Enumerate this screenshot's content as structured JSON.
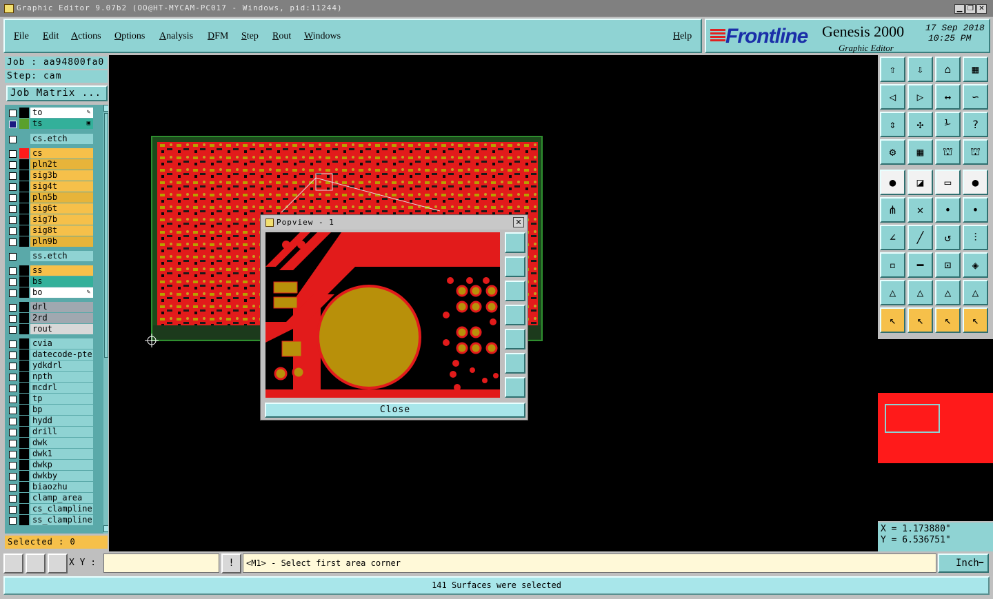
{
  "window": {
    "title": "Graphic Editor 9.07b2 (OO@HT-MYCAM-PC017 - Windows, pid:11244)",
    "btn_min": "▁",
    "btn_max": "❐",
    "btn_close": "✕"
  },
  "menu": {
    "items": [
      "File",
      "Edit",
      "Actions",
      "Options",
      "Analysis",
      "DFM",
      "Step",
      "Rout",
      "Windows"
    ],
    "help": "Help"
  },
  "brand": {
    "logo": "Frontline",
    "product": "Genesis 2000",
    "subtitle": "Graphic Editor",
    "date": "17 Sep 2018",
    "time": "10:25 PM"
  },
  "left": {
    "job": "Job : aa94800fa0",
    "step": "Step: cam",
    "job_matrix": "Job Matrix ...",
    "selected": "Selected : 0"
  },
  "layers": [
    {
      "name": "to",
      "color": "#000000",
      "bg": "#ffffff",
      "active": false,
      "mark": "✎"
    },
    {
      "name": "ts",
      "color": "#5aa02c",
      "bg": "#33b09a",
      "active": true,
      "mark": "▣"
    },
    {
      "name": "cs.etch",
      "color": "",
      "bg": "#8fd3d3",
      "active": false,
      "mark": ""
    },
    {
      "name": "cs",
      "color": "#ff1a1a",
      "bg": "#f6c04a",
      "active": false,
      "mark": ""
    },
    {
      "name": "pln2t",
      "color": "#000000",
      "bg": "#e7b43a",
      "active": false,
      "mark": ""
    },
    {
      "name": "sig3b",
      "color": "#000000",
      "bg": "#f6c04a",
      "active": false,
      "mark": ""
    },
    {
      "name": "sig4t",
      "color": "#000000",
      "bg": "#f6c04a",
      "active": false,
      "mark": ""
    },
    {
      "name": "pln5b",
      "color": "#000000",
      "bg": "#e7b43a",
      "active": false,
      "mark": ""
    },
    {
      "name": "sig6t",
      "color": "#000000",
      "bg": "#f6c04a",
      "active": false,
      "mark": ""
    },
    {
      "name": "sig7b",
      "color": "#000000",
      "bg": "#f6c04a",
      "active": false,
      "mark": ""
    },
    {
      "name": "sig8t",
      "color": "#000000",
      "bg": "#f6c04a",
      "active": false,
      "mark": ""
    },
    {
      "name": "pln9b",
      "color": "#000000",
      "bg": "#e7b43a",
      "active": false,
      "mark": ""
    },
    {
      "name": "ss.etch",
      "color": "",
      "bg": "#8fd3d3",
      "active": false,
      "mark": ""
    },
    {
      "name": "ss",
      "color": "#000000",
      "bg": "#f6c04a",
      "active": false,
      "mark": ""
    },
    {
      "name": "bs",
      "color": "#000000",
      "bg": "#33b09a",
      "active": false,
      "mark": ""
    },
    {
      "name": "bo",
      "color": "#000000",
      "bg": "#ffffff",
      "active": false,
      "mark": "✎"
    },
    {
      "name": "drl",
      "color": "#000000",
      "bg": "#a0a8b0",
      "active": false,
      "mark": ""
    },
    {
      "name": "2rd",
      "color": "#000000",
      "bg": "#a0a8b0",
      "active": false,
      "mark": ""
    },
    {
      "name": "rout",
      "color": "#000000",
      "bg": "#d8d8d8",
      "active": false,
      "mark": ""
    },
    {
      "name": "cvia",
      "color": "#000000",
      "bg": "#8fd3d3",
      "active": false,
      "mark": ""
    },
    {
      "name": "datecode-pte",
      "color": "#000000",
      "bg": "#8fd3d3",
      "active": false,
      "mark": ""
    },
    {
      "name": "ydkdrl",
      "color": "#000000",
      "bg": "#8fd3d3",
      "active": false,
      "mark": ""
    },
    {
      "name": "npth",
      "color": "#000000",
      "bg": "#8fd3d3",
      "active": false,
      "mark": ""
    },
    {
      "name": "mcdrl",
      "color": "#000000",
      "bg": "#8fd3d3",
      "active": false,
      "mark": ""
    },
    {
      "name": "tp",
      "color": "#000000",
      "bg": "#8fd3d3",
      "active": false,
      "mark": ""
    },
    {
      "name": "bp",
      "color": "#000000",
      "bg": "#8fd3d3",
      "active": false,
      "mark": ""
    },
    {
      "name": "hydd",
      "color": "#000000",
      "bg": "#8fd3d3",
      "active": false,
      "mark": ""
    },
    {
      "name": "drill",
      "color": "#000000",
      "bg": "#8fd3d3",
      "active": false,
      "mark": ""
    },
    {
      "name": "dwk",
      "color": "#000000",
      "bg": "#8fd3d3",
      "active": false,
      "mark": ""
    },
    {
      "name": "dwk1",
      "color": "#000000",
      "bg": "#8fd3d3",
      "active": false,
      "mark": ""
    },
    {
      "name": "dwkp",
      "color": "#000000",
      "bg": "#8fd3d3",
      "active": false,
      "mark": ""
    },
    {
      "name": "dwkby",
      "color": "#000000",
      "bg": "#8fd3d3",
      "active": false,
      "mark": ""
    },
    {
      "name": "biaozhu",
      "color": "#000000",
      "bg": "#8fd3d3",
      "active": false,
      "mark": ""
    },
    {
      "name": "clamp_area",
      "color": "#000000",
      "bg": "#8fd3d3",
      "active": false,
      "mark": ""
    },
    {
      "name": "cs_clampline",
      "color": "#000000",
      "bg": "#8fd3d3",
      "active": false,
      "mark": ""
    },
    {
      "name": "ss_clampline",
      "color": "#000000",
      "bg": "#8fd3d3",
      "active": false,
      "mark": ""
    }
  ],
  "coords": {
    "x": "X = 1.173880\"",
    "y": "Y = 6.536751\""
  },
  "bottom": {
    "xy_label": "X Y :",
    "xy_value": "",
    "bang": "!",
    "prompt": "<M1> - Select first area corner",
    "unit": "Inch",
    "status": "141 Surfaces were selected"
  },
  "popup": {
    "title": "Popview - 1",
    "close": "Close"
  },
  "toolbar_icons": [
    "zoom-home-icon",
    "zoom-page-icon",
    "zoom-house-icon",
    "zoom-window-icon",
    "pan-left-icon",
    "pan-right-icon",
    "mirror-icon",
    "snap-icon",
    "zoom-in-icon",
    "zoom-out-icon",
    "ratio-icon",
    "query-icon",
    "measure-tool-icon",
    "grid-icon",
    "layer-red-icon",
    "layer-blue-icon",
    "feature-pad-icon",
    "line-red-blue-icon",
    "ruler-icon",
    "dot-icon",
    "connect-nodes-icon",
    "cross-nodes-icon",
    "point-red-icon",
    "point-blue-icon",
    "angle-icon",
    "line-cut-icon",
    "arc-icon",
    "split-icon",
    "square-point-icon",
    "minus-line-icon",
    "center-icon",
    "shapes-icon",
    "triangle-a-icon",
    "triangle-b-icon",
    "triangle-c-icon",
    "triangle-d-icon",
    "select-arrow-icon",
    "select-red-icon",
    "select-circle-icon",
    "select-path-icon"
  ]
}
